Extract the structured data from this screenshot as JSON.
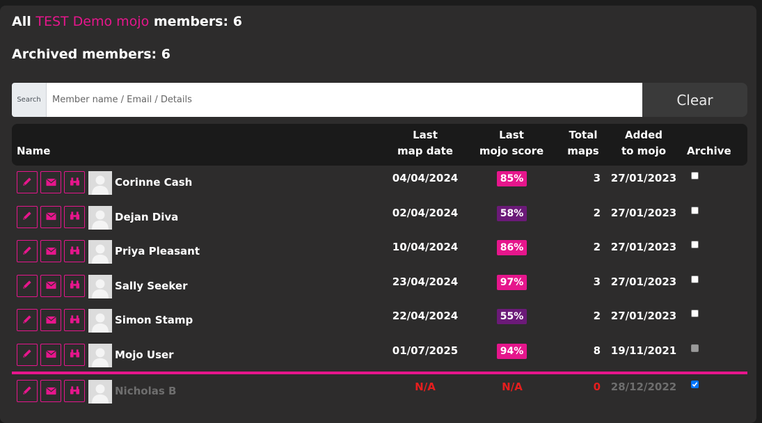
{
  "header": {
    "prefix": "All",
    "brand": "TEST Demo mojo",
    "suffix": "members: 6",
    "archived_label": "Archived members: 6"
  },
  "search": {
    "label": "Search",
    "placeholder": "Member name / Email / Details",
    "value": "",
    "clear_label": "Clear"
  },
  "table": {
    "columns": {
      "name": "Name",
      "last_map_date_1": "Last",
      "last_map_date_2": "map date",
      "last_mojo_1": "Last",
      "last_mojo_2": "mojo score",
      "total_1": "Total",
      "total_2": "maps",
      "added_1": "Added",
      "added_2": "to mojo",
      "archive": "Archive"
    },
    "rows": [
      {
        "name": "Corinne Cash",
        "last_map_date": "04/04/2024",
        "mojo_score": "85%",
        "score_color": "#e6168c",
        "total_maps": "3",
        "added": "27/01/2023",
        "archived": false
      },
      {
        "name": "Dejan Diva",
        "last_map_date": "02/04/2024",
        "mojo_score": "58%",
        "score_color": "#6b1a78",
        "total_maps": "2",
        "added": "27/01/2023",
        "archived": false
      },
      {
        "name": "Priya Pleasant",
        "last_map_date": "10/04/2024",
        "mojo_score": "86%",
        "score_color": "#e6168c",
        "total_maps": "2",
        "added": "27/01/2023",
        "archived": false
      },
      {
        "name": "Sally Seeker",
        "last_map_date": "23/04/2024",
        "mojo_score": "97%",
        "score_color": "#e6168c",
        "total_maps": "3",
        "added": "27/01/2023",
        "archived": false
      },
      {
        "name": "Simon Stamp",
        "last_map_date": "22/04/2024",
        "mojo_score": "55%",
        "score_color": "#6b1a78",
        "total_maps": "2",
        "added": "27/01/2023",
        "archived": false
      },
      {
        "name": "Mojo User",
        "last_map_date": "01/07/2025",
        "mojo_score": "94%",
        "score_color": "#e6168c",
        "total_maps": "8",
        "added": "19/11/2021",
        "archived": false,
        "checkbox_disabled": true
      }
    ],
    "archived_rows": [
      {
        "name": "Nicholas B",
        "last_map_date": "N/A",
        "mojo_score": "N/A",
        "total_maps": "0",
        "added": "28/12/2022",
        "archived": true
      }
    ]
  },
  "icons": {
    "edit": "pencil-icon",
    "email": "envelope-icon",
    "view": "binoculars-icon",
    "avatar": "user-silhouette"
  },
  "colors": {
    "accent": "#e6168c",
    "low_score": "#6b1a78",
    "na": "#e61e1e",
    "checkbox_checked": "#0075ff"
  }
}
